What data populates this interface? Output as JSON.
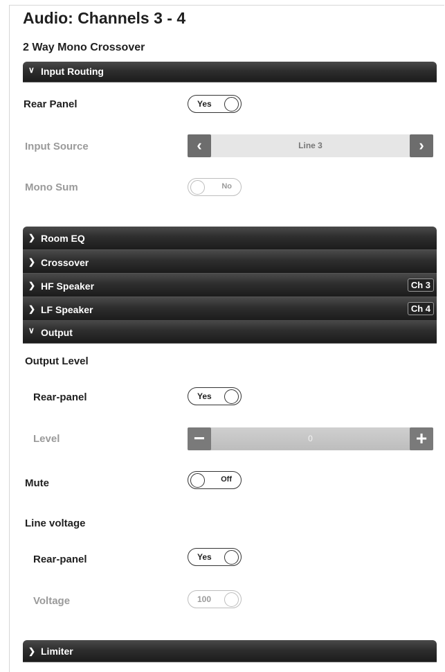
{
  "header": {
    "title": "Audio: Channels 3 - 4",
    "subtitle": "2 Way Mono Crossover"
  },
  "sections": {
    "input_routing": "Input Routing",
    "room_eq": "Room EQ",
    "crossover": "Crossover",
    "hf_speaker": "HF Speaker",
    "hf_badge": "Ch 3",
    "lf_speaker": "LF Speaker",
    "lf_badge": "Ch 4",
    "output": "Output",
    "limiter": "Limiter"
  },
  "input_routing": {
    "rear_panel_label": "Rear Panel",
    "rear_panel_value": "Yes",
    "input_source_label": "Input Source",
    "input_source_value": "Line 3",
    "mono_sum_label": "Mono Sum",
    "mono_sum_value": "No"
  },
  "output": {
    "output_level_label": "Output Level",
    "rear_panel_label": "Rear-panel",
    "rear_panel_value": "Yes",
    "level_label": "Level",
    "level_value": "0",
    "mute_label": "Mute",
    "mute_value": "Off",
    "line_voltage_label": "Line voltage",
    "lv_rear_panel_label": "Rear-panel",
    "lv_rear_panel_value": "Yes",
    "voltage_label": "Voltage",
    "voltage_value": "100"
  },
  "icons": {
    "chevron_down": "chevron-down-icon",
    "chevron_right": "chevron-right-icon",
    "prev": "chevron-left-icon",
    "next": "chevron-right-icon",
    "minus": "minus-icon",
    "plus": "plus-icon"
  },
  "colors": {
    "bar_dark": "#1c1c1c",
    "button_gray": "#6d6d6d",
    "disabled_text": "#9a9a9a"
  }
}
